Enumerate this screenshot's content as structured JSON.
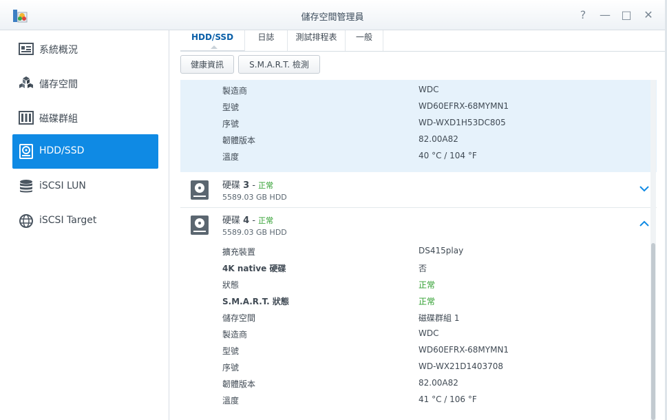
{
  "window": {
    "title": "儲存空間管理員",
    "controls": [
      "?",
      "—",
      "□",
      "✕"
    ]
  },
  "sidebar": {
    "items": [
      {
        "label": "系統概況",
        "icon": "overview-icon"
      },
      {
        "label": "儲存空間",
        "icon": "volume-cubes-icon"
      },
      {
        "label": "磁碟群組",
        "icon": "disk-group-icon"
      },
      {
        "label": "HDD/SSD",
        "icon": "hdd-icon",
        "active": true
      },
      {
        "label": "iSCSI LUN",
        "icon": "database-icon"
      },
      {
        "label": "iSCSI Target",
        "icon": "globe-icon"
      }
    ]
  },
  "tabs": [
    "HDD/SSD",
    "日誌",
    "測試排程表",
    "一般"
  ],
  "toolbar": {
    "health_label": "健康資訊",
    "smart_label": "S.M.A.R.T. 檢測"
  },
  "disk2_details": [
    {
      "label": "製造商",
      "value": "WDC"
    },
    {
      "label": "型號",
      "value": "WD60EFRX-68MYMN1"
    },
    {
      "label": "序號",
      "value": "WD-WXD1H53DC805"
    },
    {
      "label": "韌體版本",
      "value": "82.00A82"
    },
    {
      "label": "溫度",
      "value": "40 °C / 104 °F"
    }
  ],
  "disk3": {
    "name": "硬碟",
    "number": "3",
    "separator": " - ",
    "status": "正常",
    "size": "5589.03 GB HDD"
  },
  "disk4": {
    "name": "硬碟",
    "number": "4",
    "separator": " - ",
    "status": "正常",
    "size": "5589.03 GB HDD",
    "details": [
      {
        "label": "擴充裝置",
        "value": "DS415play"
      },
      {
        "label": "4K native 硬碟",
        "value": "否"
      },
      {
        "label": "狀態",
        "value": "正常"
      },
      {
        "label": "S.M.A.R.T. 狀態",
        "value": "正常"
      },
      {
        "label": "儲存空間",
        "value": "磁碟群組 1"
      },
      {
        "label": "製造商",
        "value": "WDC"
      },
      {
        "label": "型號",
        "value": "WD60EFRX-68MYMN1"
      },
      {
        "label": "序號",
        "value": "WD-WX21D1403708"
      },
      {
        "label": "韌體版本",
        "value": "82.00A82"
      },
      {
        "label": "溫度",
        "value": "41 °C / 106 °F"
      }
    ]
  },
  "colors": {
    "accent": "#0f8ae4",
    "selected_bg": "#e6f2fb",
    "status_ok": "#2e9e2e"
  }
}
